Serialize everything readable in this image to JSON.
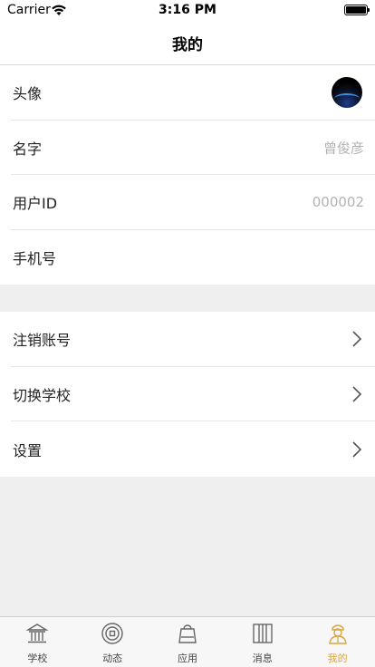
{
  "status_bar": {
    "carrier": "Carrier",
    "time": "3:16 PM"
  },
  "nav": {
    "title": "我的"
  },
  "profile": {
    "avatar_label": "头像",
    "name_label": "名字",
    "name_value": "曾俊彦",
    "user_id_label": "用户ID",
    "user_id_value": "000002",
    "phone_label": "手机号"
  },
  "settings": {
    "deactivate": "注销账号",
    "switch_school": "切换学校",
    "settings": "设置"
  },
  "tabs": [
    {
      "label": "学校",
      "icon": "school-icon"
    },
    {
      "label": "动态",
      "icon": "activity-icon"
    },
    {
      "label": "应用",
      "icon": "apps-icon"
    },
    {
      "label": "消息",
      "icon": "messages-icon"
    },
    {
      "label": "我的",
      "icon": "profile-icon",
      "active": true
    }
  ],
  "colors": {
    "active_tab": "#d9a441",
    "value_text": "#b3b3b3"
  }
}
